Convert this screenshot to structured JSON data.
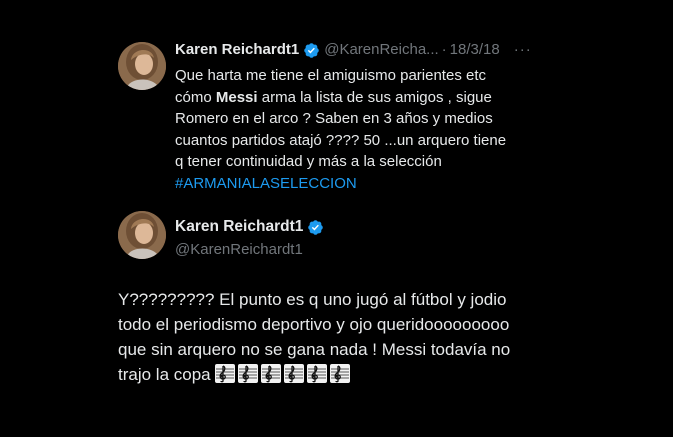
{
  "quoted_tweet": {
    "author_name": "Karen Reichardt1",
    "handle": "@KarenReicha...",
    "separator": "·",
    "date": "18/3/18",
    "more": "···",
    "text_lines": [
      "Que harta me tiene el amiguismo parientes etc",
      "cómo",
      "Messi",
      "arma la lista de sus amigos  , sigue",
      "Romero en el arco ? Saben en 3 años y medios",
      "cuantos partidos atajó ???? 50 ...un arquero tiene",
      "q tener continuidad y más a la selección"
    ],
    "hashtag": "#ARMANIALASELECCION",
    "verified_icon": "verified-badge-icon",
    "avatar": "profile-photo"
  },
  "reply_tweet": {
    "author_name": "Karen Reichardt1",
    "handle": "@KarenReichardt1",
    "verified_icon": "verified-badge-icon",
    "avatar": "profile-photo",
    "text_lines": [
      "Y????????? El punto es q uno jugó al fútbol y jodio",
      "todo el periodismo deportivo y ojo queridooooooooo",
      "que sin arquero no se gana nada ! Messi todavía no",
      "trajo la copa"
    ],
    "emoji_count_icon": "treble-clef-emoji",
    "emoji_repeat": 6
  },
  "colors": {
    "background": "#000000",
    "text": "#e7e9ea",
    "muted": "#71767b",
    "accent": "#1d9bf0"
  }
}
